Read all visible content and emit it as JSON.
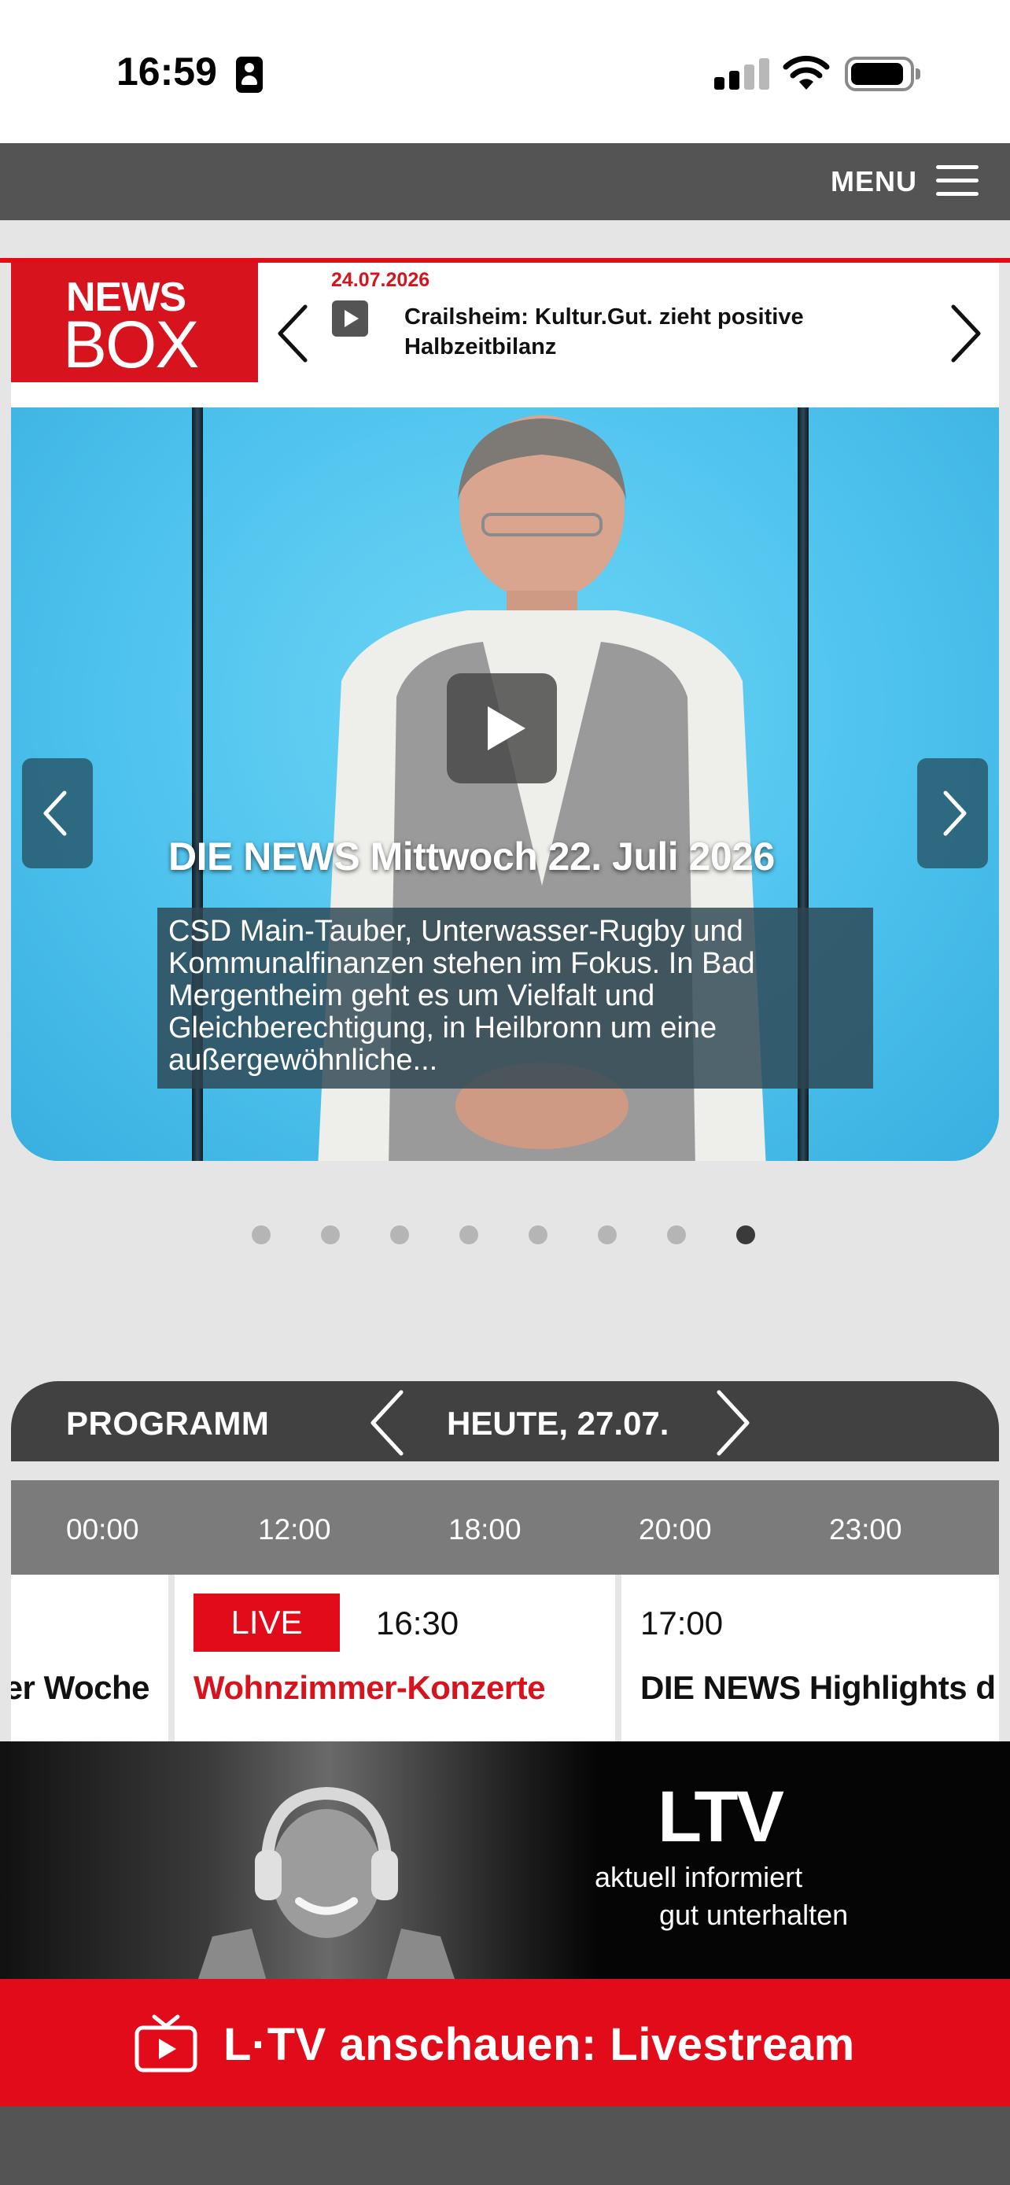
{
  "status_bar": {
    "time": "16:59"
  },
  "nav": {
    "menu_label": "MENU"
  },
  "newsbox": {
    "logo_line1": "NEWS",
    "logo_line2": "BOX",
    "date": "24.07.2026",
    "headline": "Crailsheim: Kultur.Gut. zieht positive Halbzeitbilanz"
  },
  "hero": {
    "title": "DIE NEWS Mittwoch 22. Juli 2026",
    "description": "CSD Main-Tauber, Unterwasser-Rugby und Kommunalfinanzen stehen im Fokus. In Bad Mergentheim geht es um Vielfalt und Gleichberechtigung, in Heilbronn um eine außergewöhnliche...",
    "slide_count": 8,
    "active_slide": 8
  },
  "programm": {
    "title": "PROGRAMM",
    "date_label": "HEUTE, 27.07.",
    "timeline": [
      "00:00",
      "12:00",
      "18:00",
      "20:00",
      "23:00"
    ],
    "slots": [
      {
        "title": "Kultur der Woche",
        "visible_title": "er Woche"
      },
      {
        "live_label": "LIVE",
        "time": "16:30",
        "title": "Wohnzimmer-Konzerte"
      },
      {
        "time": "17:00",
        "title": "DIE NEWS Highlights d"
      }
    ]
  },
  "banner": {
    "logo": "LTV",
    "line1": "aktuell informiert",
    "line2": "gut unterhalten"
  },
  "livestream": {
    "label": "L·TV anschauen: Livestream"
  },
  "colors": {
    "brand_red": "#e10b1a",
    "nav_gray": "#545454",
    "program_dark": "#414141",
    "timeline_gray": "#7b7b7b"
  },
  "icons": [
    "portrait-lock-icon",
    "cellular-signal-icon",
    "wifi-icon",
    "battery-icon",
    "hamburger-menu-icon",
    "chevron-left-icon",
    "chevron-right-icon",
    "play-icon",
    "tv-icon"
  ]
}
